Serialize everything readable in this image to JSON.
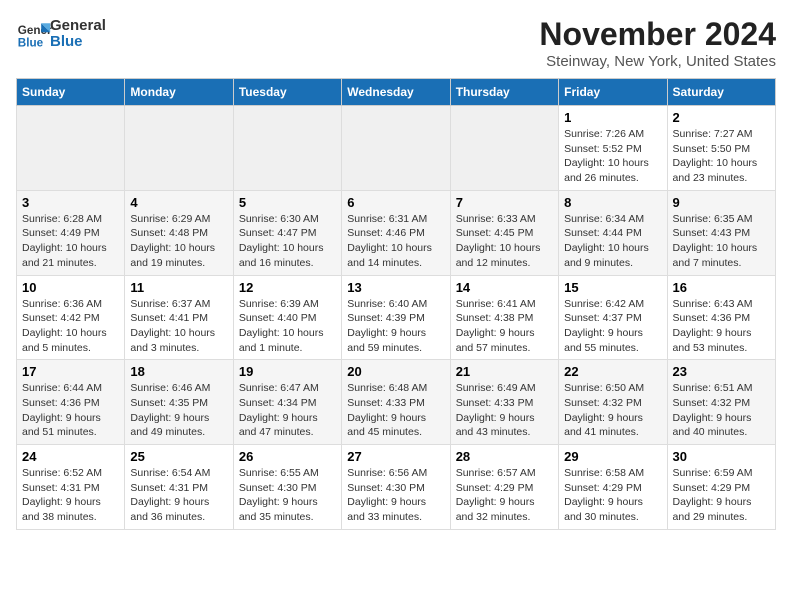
{
  "logo": {
    "line1": "General",
    "line2": "Blue"
  },
  "title": "November 2024",
  "subtitle": "Steinway, New York, United States",
  "weekdays": [
    "Sunday",
    "Monday",
    "Tuesday",
    "Wednesday",
    "Thursday",
    "Friday",
    "Saturday"
  ],
  "weeks": [
    [
      {
        "day": "",
        "text": ""
      },
      {
        "day": "",
        "text": ""
      },
      {
        "day": "",
        "text": ""
      },
      {
        "day": "",
        "text": ""
      },
      {
        "day": "",
        "text": ""
      },
      {
        "day": "1",
        "text": "Sunrise: 7:26 AM\nSunset: 5:52 PM\nDaylight: 10 hours and 26 minutes."
      },
      {
        "day": "2",
        "text": "Sunrise: 7:27 AM\nSunset: 5:50 PM\nDaylight: 10 hours and 23 minutes."
      }
    ],
    [
      {
        "day": "3",
        "text": "Sunrise: 6:28 AM\nSunset: 4:49 PM\nDaylight: 10 hours and 21 minutes."
      },
      {
        "day": "4",
        "text": "Sunrise: 6:29 AM\nSunset: 4:48 PM\nDaylight: 10 hours and 19 minutes."
      },
      {
        "day": "5",
        "text": "Sunrise: 6:30 AM\nSunset: 4:47 PM\nDaylight: 10 hours and 16 minutes."
      },
      {
        "day": "6",
        "text": "Sunrise: 6:31 AM\nSunset: 4:46 PM\nDaylight: 10 hours and 14 minutes."
      },
      {
        "day": "7",
        "text": "Sunrise: 6:33 AM\nSunset: 4:45 PM\nDaylight: 10 hours and 12 minutes."
      },
      {
        "day": "8",
        "text": "Sunrise: 6:34 AM\nSunset: 4:44 PM\nDaylight: 10 hours and 9 minutes."
      },
      {
        "day": "9",
        "text": "Sunrise: 6:35 AM\nSunset: 4:43 PM\nDaylight: 10 hours and 7 minutes."
      }
    ],
    [
      {
        "day": "10",
        "text": "Sunrise: 6:36 AM\nSunset: 4:42 PM\nDaylight: 10 hours and 5 minutes."
      },
      {
        "day": "11",
        "text": "Sunrise: 6:37 AM\nSunset: 4:41 PM\nDaylight: 10 hours and 3 minutes."
      },
      {
        "day": "12",
        "text": "Sunrise: 6:39 AM\nSunset: 4:40 PM\nDaylight: 10 hours and 1 minute."
      },
      {
        "day": "13",
        "text": "Sunrise: 6:40 AM\nSunset: 4:39 PM\nDaylight: 9 hours and 59 minutes."
      },
      {
        "day": "14",
        "text": "Sunrise: 6:41 AM\nSunset: 4:38 PM\nDaylight: 9 hours and 57 minutes."
      },
      {
        "day": "15",
        "text": "Sunrise: 6:42 AM\nSunset: 4:37 PM\nDaylight: 9 hours and 55 minutes."
      },
      {
        "day": "16",
        "text": "Sunrise: 6:43 AM\nSunset: 4:36 PM\nDaylight: 9 hours and 53 minutes."
      }
    ],
    [
      {
        "day": "17",
        "text": "Sunrise: 6:44 AM\nSunset: 4:36 PM\nDaylight: 9 hours and 51 minutes."
      },
      {
        "day": "18",
        "text": "Sunrise: 6:46 AM\nSunset: 4:35 PM\nDaylight: 9 hours and 49 minutes."
      },
      {
        "day": "19",
        "text": "Sunrise: 6:47 AM\nSunset: 4:34 PM\nDaylight: 9 hours and 47 minutes."
      },
      {
        "day": "20",
        "text": "Sunrise: 6:48 AM\nSunset: 4:33 PM\nDaylight: 9 hours and 45 minutes."
      },
      {
        "day": "21",
        "text": "Sunrise: 6:49 AM\nSunset: 4:33 PM\nDaylight: 9 hours and 43 minutes."
      },
      {
        "day": "22",
        "text": "Sunrise: 6:50 AM\nSunset: 4:32 PM\nDaylight: 9 hours and 41 minutes."
      },
      {
        "day": "23",
        "text": "Sunrise: 6:51 AM\nSunset: 4:32 PM\nDaylight: 9 hours and 40 minutes."
      }
    ],
    [
      {
        "day": "24",
        "text": "Sunrise: 6:52 AM\nSunset: 4:31 PM\nDaylight: 9 hours and 38 minutes."
      },
      {
        "day": "25",
        "text": "Sunrise: 6:54 AM\nSunset: 4:31 PM\nDaylight: 9 hours and 36 minutes."
      },
      {
        "day": "26",
        "text": "Sunrise: 6:55 AM\nSunset: 4:30 PM\nDaylight: 9 hours and 35 minutes."
      },
      {
        "day": "27",
        "text": "Sunrise: 6:56 AM\nSunset: 4:30 PM\nDaylight: 9 hours and 33 minutes."
      },
      {
        "day": "28",
        "text": "Sunrise: 6:57 AM\nSunset: 4:29 PM\nDaylight: 9 hours and 32 minutes."
      },
      {
        "day": "29",
        "text": "Sunrise: 6:58 AM\nSunset: 4:29 PM\nDaylight: 9 hours and 30 minutes."
      },
      {
        "day": "30",
        "text": "Sunrise: 6:59 AM\nSunset: 4:29 PM\nDaylight: 9 hours and 29 minutes."
      }
    ]
  ]
}
